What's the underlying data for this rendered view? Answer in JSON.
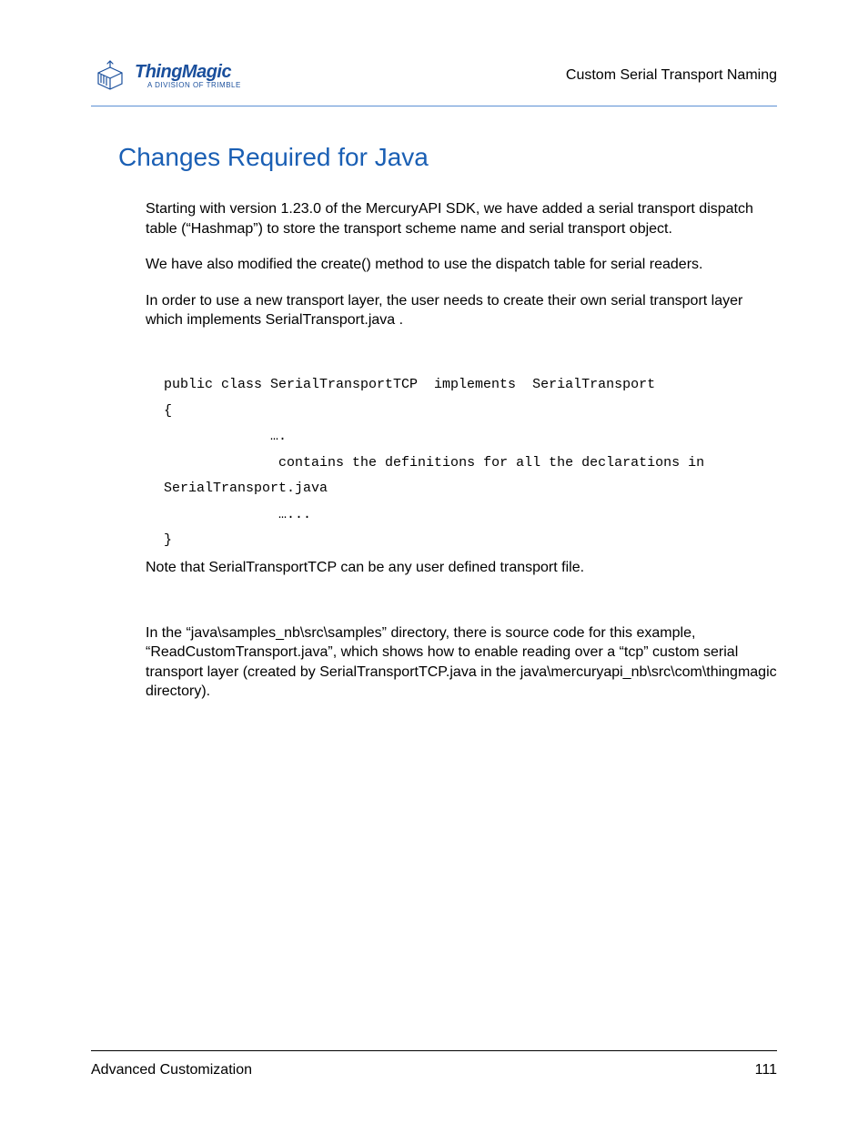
{
  "header": {
    "logo_main": "ThingMagic",
    "logo_sub": "A DIVISION OF TRIMBLE",
    "page_header": "Custom Serial Transport Naming"
  },
  "section": {
    "title": "Changes Required for Java",
    "para1": "Starting with version 1.23.0 of the MercuryAPI SDK, we have added a serial transport dispatch table (“Hashmap”) to store the transport scheme name and serial transport object.",
    "para2": "We have also modified the create() method to use the dispatch table for serial readers.",
    "para3": "In order to  use a new transport layer, the user needs to create their own serial transport layer which implements  SerialTransport.java .",
    "code_line1": "public class SerialTransportTCP  implements  SerialTransport",
    "code_line2": "{",
    "code_line3": "             ….",
    "code_line4": "              contains the definitions for all the declarations in SerialTransport.java",
    "code_line5": "              …...",
    "code_line6": "}",
    "note": "Note that SerialTransportTCP  can be  any user defined transport file.",
    "para4": "In the “java\\samples_nb\\src\\samples” directory, there is source code for this example, “ReadCustomTransport.java”, which shows how to enable reading over a “tcp” custom serial transport layer (created by SerialTransportTCP.java in the java\\mercuryapi_nb\\src\\com\\thingmagic directory)."
  },
  "footer": {
    "left": "Advanced Customization",
    "right": "111"
  }
}
